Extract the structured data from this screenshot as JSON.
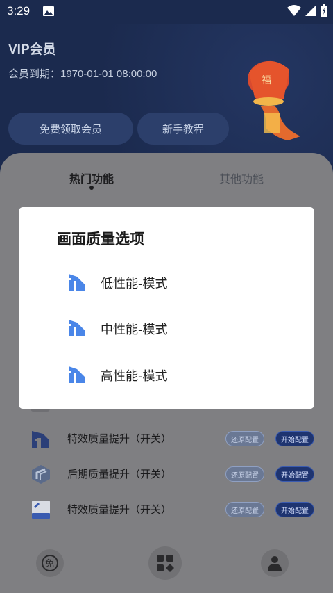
{
  "status_bar": {
    "time": "3:29"
  },
  "header": {
    "title": "VIP会员",
    "expire_text": "会员到期：1970-01-01 08:00:00",
    "buttons": {
      "free_vip": "免费领取会员",
      "guide": "新手教程"
    }
  },
  "tabs": {
    "hot": "热门功能",
    "other": "其他功能"
  },
  "list_rows": [
    {
      "label": "特效质量提升（开关）",
      "restore": "还原配置",
      "start": "开始配置"
    },
    {
      "label": "后期质量提升（开关）",
      "restore": "还原配置",
      "start": "开始配置"
    },
    {
      "label": "特效质量提升（开关）",
      "restore": "还原配置",
      "start": "开始配置"
    }
  ],
  "dialog": {
    "title": "画面质量选项",
    "options": [
      "低性能-模式",
      "中性能-模式",
      "高性能-模式"
    ]
  },
  "bottom_nav": {
    "free_icon_label": "免"
  },
  "colors": {
    "accent": "#4a86e8",
    "dialog_bg": "#ffffff",
    "header_bg": "#1b2a4e"
  }
}
